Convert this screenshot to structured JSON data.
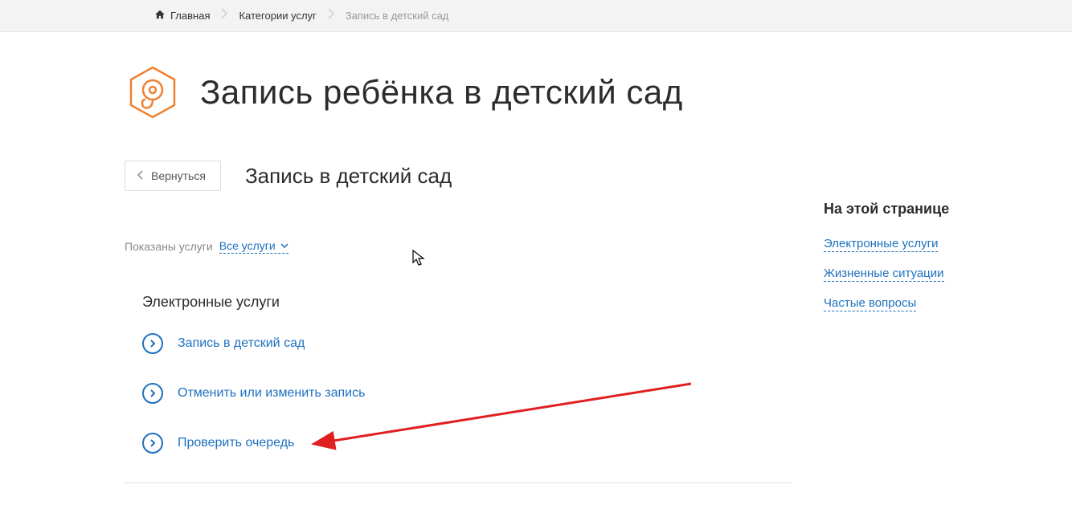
{
  "breadcrumb": {
    "items": [
      {
        "label": "Главная"
      },
      {
        "label": "Категории услуг"
      },
      {
        "label": "Запись в детский сад"
      }
    ]
  },
  "header": {
    "title": "Запись ребёнка в детский сад"
  },
  "sub": {
    "back_label": "Вернуться",
    "title": "Запись в детский сад"
  },
  "filter": {
    "label": "Показаны услуги",
    "selected": "Все услуги"
  },
  "section": {
    "title": "Электронные услуги",
    "items": [
      {
        "label": "Запись в детский сад"
      },
      {
        "label": "Отменить или изменить запись"
      },
      {
        "label": "Проверить очередь"
      }
    ]
  },
  "sidebar": {
    "title": "На этой странице",
    "links": [
      {
        "label": "Электронные услуги"
      },
      {
        "label": "Жизненные ситуации"
      },
      {
        "label": "Частые вопросы"
      }
    ]
  }
}
